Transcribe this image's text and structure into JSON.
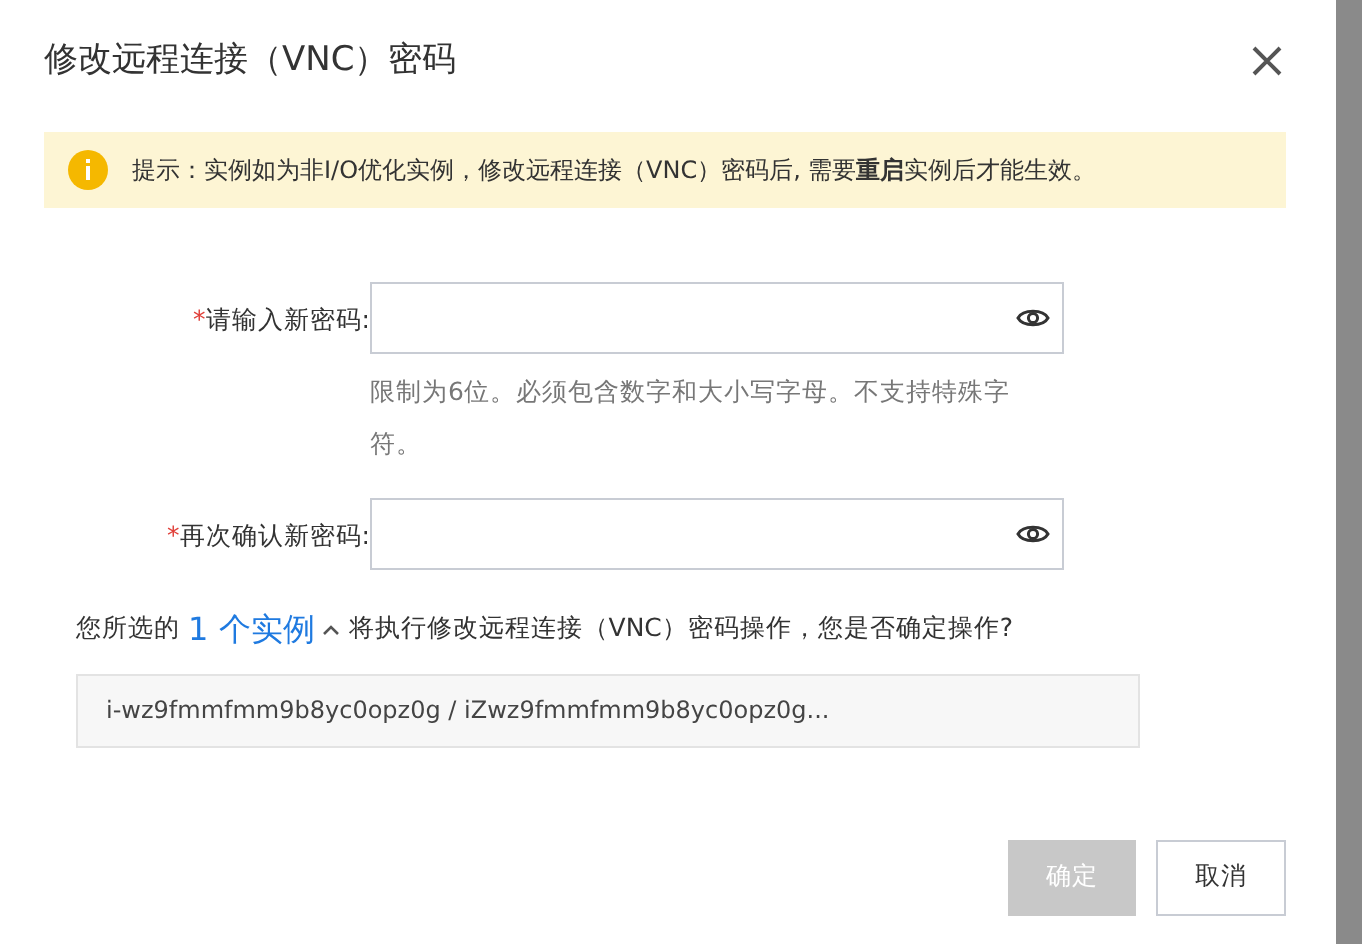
{
  "dialog": {
    "title": "修改远程连接（VNC）密码"
  },
  "notice": {
    "text": "提示：实例如为非I/O优化实例，修改远程连接（VNC）密码后, 需要**重启**实例后才能生效。"
  },
  "fields": [
    {
      "required_mark": "*",
      "label": "请输入新密码:",
      "hint": "限制为6位。必须包含数字和大小写字母。不支持特殊字符。"
    },
    {
      "required_mark": "*",
      "label": "再次确认新密码:"
    }
  ],
  "selection": {
    "prefix": "您所选的",
    "link": "1 个实例",
    "suffix": "将执行修改远程连接（VNC）密码操作，您是否确定操作?",
    "instances": "i-wz9fmmfmm9b8yc0opz0g / iZwz9fmmfmm9b8yc0opz0g..."
  },
  "buttons": [
    {
      "label": "确定",
      "kind": "primary",
      "disabled": true
    },
    {
      "label": "取消",
      "kind": "secondary"
    }
  ]
}
